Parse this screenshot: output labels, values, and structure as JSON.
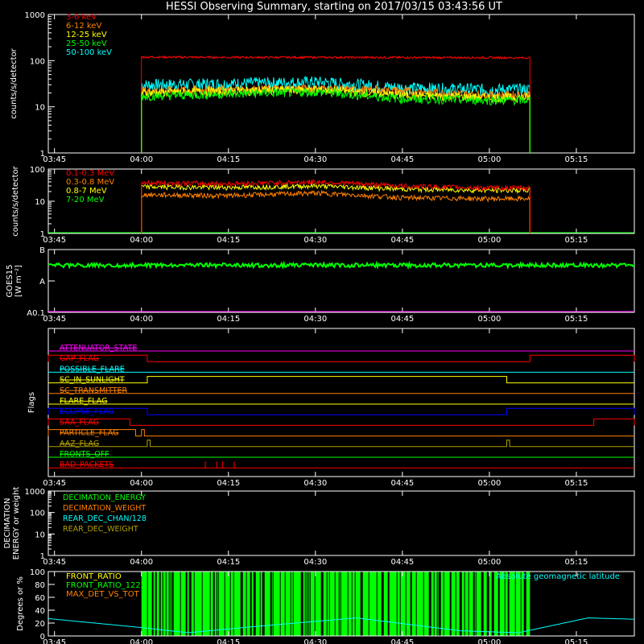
{
  "title": "HESSI Observing Summary, starting on 2017/03/15 03:43:56 UT",
  "time_ticks": [
    "03:45",
    "04:00",
    "04:15",
    "04:30",
    "04:45",
    "05:00",
    "05:15"
  ],
  "colors": {
    "red": "#ff0000",
    "orange": "#ff8000",
    "yellow": "#ffff00",
    "green": "#00ff00",
    "cyan": "#00ffff",
    "magenta": "#ff00ff",
    "blue": "#0000ff",
    "olive": "#b0a000",
    "axis": "#ffffff",
    "bg": "#000000"
  },
  "chart_data": [
    {
      "type": "line",
      "ylabel": "counts/s/detector",
      "yscale": "log",
      "ylim": [
        1,
        1000
      ],
      "y_ticks": [
        "1",
        "10",
        "100",
        "1000"
      ],
      "xlim": [
        "03:43:56",
        "05:25:00"
      ],
      "observation_window": [
        "04:00",
        "05:07"
      ],
      "series": [
        {
          "name": "3-6 keV",
          "color": "#ff0000",
          "x": [
            "04:00",
            "04:15",
            "04:30",
            "04:45",
            "05:00",
            "05:07"
          ],
          "values": [
            120,
            118,
            118,
            117,
            116,
            115
          ]
        },
        {
          "name": "6-12 keV",
          "color": "#ff8000",
          "x": [
            "04:00",
            "04:15",
            "04:30",
            "04:45",
            "05:00",
            "05:07"
          ],
          "values": [
            22,
            24,
            25,
            22,
            18,
            18
          ]
        },
        {
          "name": "12-25 keV",
          "color": "#ffff00",
          "x": [
            "04:00",
            "04:15",
            "04:30",
            "04:45",
            "05:00",
            "05:07"
          ],
          "values": [
            20,
            22,
            24,
            18,
            16,
            16
          ]
        },
        {
          "name": "25-50 keV",
          "color": "#00ff00",
          "x": [
            "04:00",
            "04:15",
            "04:30",
            "04:45",
            "05:00",
            "05:07"
          ],
          "values": [
            17,
            19,
            21,
            15,
            14,
            14
          ]
        },
        {
          "name": "50-100 keV",
          "color": "#00ffff",
          "x": [
            "04:00",
            "04:15",
            "04:30",
            "04:45",
            "05:00",
            "05:07"
          ],
          "values": [
            30,
            32,
            35,
            26,
            24,
            24
          ]
        }
      ]
    },
    {
      "type": "line",
      "ylabel": "counts/s/detector",
      "yscale": "log",
      "ylim": [
        1,
        100
      ],
      "y_ticks": [
        "1",
        "10",
        "100"
      ],
      "series": [
        {
          "name": "0.1-0.3 MeV",
          "color": "#ff0000",
          "x": [
            "04:00",
            "04:15",
            "04:30",
            "04:45",
            "05:00",
            "05:07"
          ],
          "values": [
            38,
            35,
            40,
            30,
            26,
            26
          ]
        },
        {
          "name": "0.3-0.8 MeV",
          "color": "#ff8000",
          "x": [
            "04:00",
            "04:15",
            "04:30",
            "04:45",
            "05:00",
            "05:07"
          ],
          "values": [
            16,
            15,
            18,
            13,
            12,
            12
          ]
        },
        {
          "name": "0.8-7 MeV",
          "color": "#ffff00",
          "x": [
            "04:00",
            "04:15",
            "04:30",
            "04:45",
            "05:00",
            "05:07"
          ],
          "values": [
            28,
            27,
            30,
            24,
            22,
            22
          ]
        },
        {
          "name": "7-20 MeV",
          "color": "#00ff00",
          "values": [
            1
          ]
        }
      ]
    },
    {
      "type": "line",
      "ylabel_lines": [
        "GOES15",
        "[W m⁻²]"
      ],
      "y_ticks": [
        "A0.1",
        "A",
        "B"
      ],
      "series": [
        {
          "color": "#00ff00",
          "level_between_A_and_B": 0.75
        }
      ]
    },
    {
      "type": "line",
      "ylabel": "Flags",
      "flags": [
        {
          "name": "ATTENUATOR_STATE",
          "color": "#ff00ff"
        },
        {
          "name": "GAP_FLAG",
          "color": "#ff0000",
          "high_intervals": [
            [
              "03:43:56",
              "04:01"
            ],
            [
              "05:07",
              "05:25:00"
            ]
          ]
        },
        {
          "name": "POSSIBLE_FLARE",
          "color": "#00ffff"
        },
        {
          "name": "SC_IN_SUNLIGHT",
          "color": "#ffff00",
          "high_intervals": [
            [
              "04:01",
              "05:03"
            ]
          ]
        },
        {
          "name": "SC_TRANSMITTER",
          "color": "#ff8000"
        },
        {
          "name": "FLARE_FLAG",
          "color": "#ffff00"
        },
        {
          "name": "ECLIPSE_FLAG",
          "color": "#0000ff",
          "high_intervals": [
            [
              "03:43:56",
              "04:01"
            ],
            [
              "05:03",
              "05:25:00"
            ]
          ]
        },
        {
          "name": "SAA_FLAG",
          "color": "#ff0000",
          "high_intervals": [
            [
              "03:43:56",
              "03:58"
            ],
            [
              "05:18",
              "05:25:00"
            ]
          ]
        },
        {
          "name": "PARTICLE_FLAG",
          "color": "#ff8000",
          "high_intervals": [
            [
              "03:43:56",
              "03:59"
            ],
            [
              "04:00",
              "04:00:30"
            ]
          ]
        },
        {
          "name": "AAZ_FLAG",
          "color": "#b0a000",
          "high_intervals": [
            [
              "04:01",
              "04:01:30"
            ],
            [
              "05:03",
              "05:03:30"
            ]
          ]
        },
        {
          "name": "FRONTS_OFF",
          "color": "#00ff00"
        },
        {
          "name": "BAD_PACKETS",
          "color": "#ff0000",
          "spikes": [
            "04:11",
            "04:13",
            "04:14",
            "04:16"
          ]
        }
      ]
    },
    {
      "type": "line",
      "ylabel_lines": [
        "DECIMATION",
        "ENERGY or weight"
      ],
      "yscale": "log",
      "ylim": [
        1,
        1000
      ],
      "y_ticks": [
        "1",
        "10",
        "100",
        "1000"
      ],
      "series": [
        {
          "name": "DECIMATION_ENERGY",
          "color": "#00ff00"
        },
        {
          "name": "DECIMATION_WEIGHT",
          "color": "#ff8000"
        },
        {
          "name": "REAR_DEC_CHAN/128",
          "color": "#00ffff"
        },
        {
          "name": "REAR_DEC_WEIGHT",
          "color": "#b0a000"
        }
      ]
    },
    {
      "type": "line",
      "ylabel": "Degrees or %",
      "ylim": [
        0,
        100
      ],
      "y_ticks": [
        "0",
        "20",
        "40",
        "60",
        "80",
        "100"
      ],
      "series": [
        {
          "name": "FRONT_RATIO",
          "color": "#ffff00"
        },
        {
          "name": "FRONT_RATIO_1225",
          "color": "#00ff00",
          "active_window": [
            "04:00",
            "05:07"
          ],
          "value": 100
        },
        {
          "name": "MAX_DET_VS_TOT",
          "color": "#ff8000"
        },
        {
          "name": "Absolute geomagnetic latitude",
          "color": "#00ffff",
          "x": [
            "03:43:56",
            "04:00",
            "04:08",
            "04:20",
            "04:37",
            "04:55",
            "05:05",
            "05:17",
            "05:25:00"
          ],
          "values": [
            27,
            13,
            5,
            15,
            28,
            8,
            5,
            28,
            26
          ]
        }
      ]
    }
  ]
}
